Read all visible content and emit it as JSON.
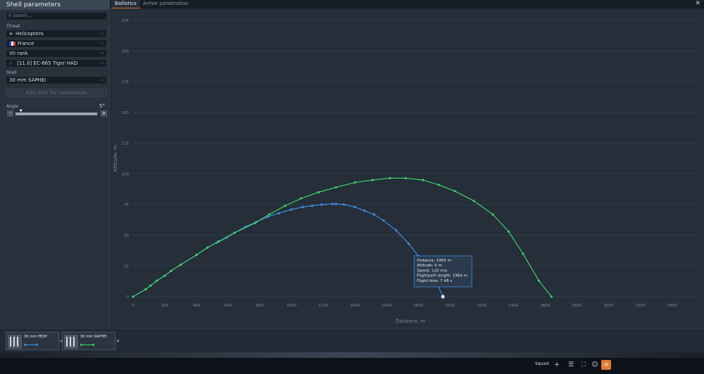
{
  "sidebar": {
    "title": "Shell parameters",
    "search_placeholder": "Search...",
    "threat_label": "Threat",
    "threat_type": {
      "value": "Helicopters",
      "icon": "helicopter-icon"
    },
    "nation": {
      "value": "France",
      "icon": "france-flag-icon"
    },
    "rank": {
      "value": "VII rank"
    },
    "vehicle": {
      "value": "[11.0] EC-665 Tiger HAD",
      "icon": "rotor-icon"
    },
    "shell_label": "Shell",
    "shell": {
      "value": "30 mm SAPHEI"
    },
    "add_shell": "Add shell for comparison",
    "angle_label": "Angle",
    "angle_value": "5°",
    "angle_level": 0.05,
    "minus": "-",
    "plus": "+"
  },
  "tabs": [
    {
      "label": "Ballistics",
      "active": true
    },
    {
      "label": "Armor penetration",
      "active": false
    }
  ],
  "close": "✕",
  "chart_data": {
    "type": "line",
    "xlabel": "Distance, m",
    "ylabel": "Altitude, m",
    "xlim": [
      0,
      3500
    ],
    "ylim": [
      0,
      225
    ],
    "xticks": [
      0,
      200,
      400,
      600,
      800,
      1000,
      1200,
      1400,
      1600,
      1800,
      2000,
      2200,
      2400,
      2600,
      2800,
      3000,
      3200,
      3400
    ],
    "yticks": [
      0,
      25,
      50,
      75,
      100,
      125,
      150,
      175,
      200,
      225
    ],
    "grid": true,
    "series": [
      {
        "color": "#3f8ee8",
        "x": [
          0,
          80,
          110,
          150,
          200,
          240,
          300,
          400,
          470,
          530,
          590,
          640,
          710,
          780,
          850,
          920,
          1000,
          1070,
          1130,
          1190,
          1260,
          1280,
          1330,
          1400,
          1460,
          1520,
          1580,
          1660,
          1740,
          1800,
          1860,
          1920,
          1955
        ],
        "y": [
          0,
          6,
          9,
          13,
          17,
          21,
          26,
          34,
          40,
          44,
          48,
          52,
          57,
          61,
          65,
          68,
          71,
          73,
          74,
          75,
          75.5,
          75.5,
          75,
          73,
          70,
          67,
          62,
          54,
          43,
          33,
          22,
          10,
          0
        ]
      },
      {
        "color": "#3fcf6a",
        "x": [
          0,
          80,
          110,
          150,
          200,
          240,
          300,
          400,
          470,
          540,
          640,
          770,
          860,
          960,
          1060,
          1170,
          1280,
          1400,
          1510,
          1620,
          1720,
          1830,
          1930,
          2030,
          2150,
          2270,
          2370,
          2460,
          2560,
          2640
        ],
        "y": [
          0,
          6,
          9,
          13,
          17,
          21,
          26,
          34,
          40,
          45,
          52,
          60,
          67,
          74,
          80,
          85,
          89,
          93,
          95,
          96.5,
          96.5,
          95,
          91,
          86,
          78,
          67,
          53,
          35,
          13,
          0
        ]
      }
    ],
    "tooltip": {
      "distance": "Distance: 1955 m",
      "altitude": "Altitude: 0 m",
      "speed": "Speed: 120 m/s",
      "flightpath": "Flightpath length: 1964 m",
      "time": "Flight time: 7.48 s"
    }
  },
  "compare": [
    {
      "name": "30 mm HEDP",
      "color": "#3f8ee8"
    },
    {
      "name": "30 mm SAPHEI",
      "color": "#3fcf6a"
    }
  ],
  "taskbar": {
    "squad": "Squad:",
    "icons": [
      "plus-icon",
      "list-icon",
      "squad-icon",
      "chat-icon",
      "mail-icon"
    ]
  }
}
